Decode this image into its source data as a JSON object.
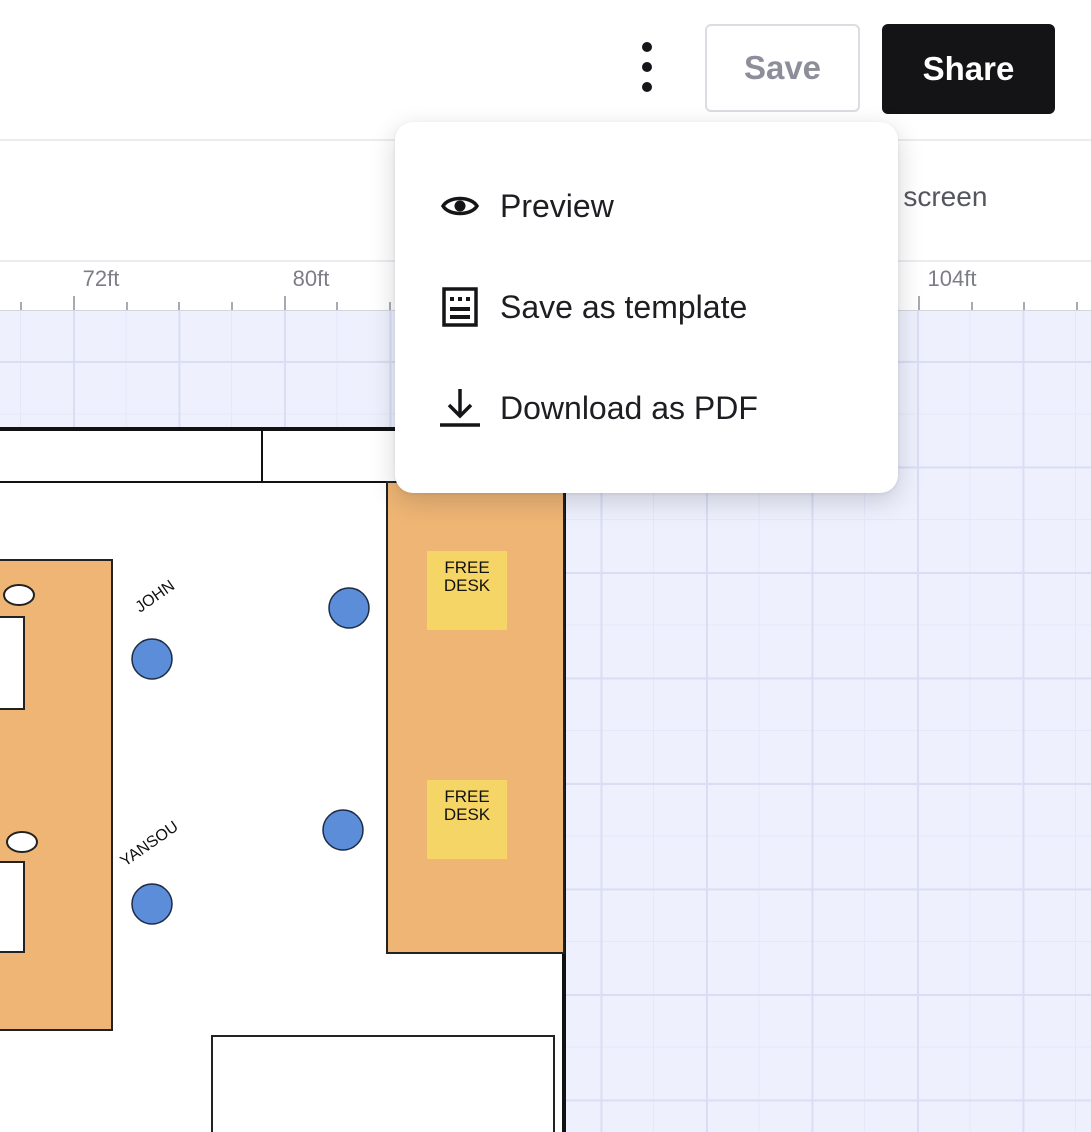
{
  "header": {
    "more_menu_icon": "vertical-ellipsis-icon",
    "save_label": "Save",
    "share_label": "Share"
  },
  "toolbar": {
    "fit_label": "o screen"
  },
  "ruler": {
    "ticks": [
      "72ft",
      "80ft",
      "104ft"
    ]
  },
  "floorplan": {
    "people": [
      "JOHN",
      "YANSOU"
    ],
    "desk_labels": [
      {
        "line1": "FREE",
        "line2": "DESK"
      },
      {
        "line1": "FREE",
        "line2": "DESK"
      }
    ],
    "colors": {
      "desk_area": "#efb574",
      "free_desk": "#f5d565",
      "person_marker": "#5b8dd9",
      "grid_background": "#eef1fd"
    }
  },
  "menu": {
    "items": [
      {
        "label": "Preview",
        "icon": "eye-icon"
      },
      {
        "label": "Save as template",
        "icon": "template-icon"
      },
      {
        "label": "Download as PDF",
        "icon": "download-icon"
      }
    ]
  }
}
